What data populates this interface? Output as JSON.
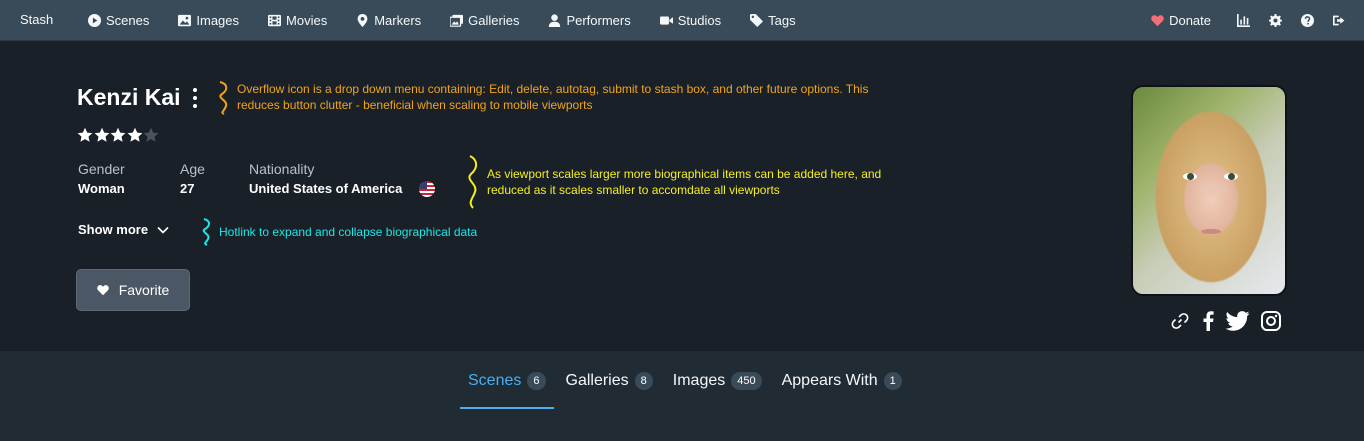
{
  "navbar": {
    "brand": "Stash",
    "items": [
      {
        "label": "Scenes",
        "icon": "play-circle-icon"
      },
      {
        "label": "Images",
        "icon": "image-icon"
      },
      {
        "label": "Movies",
        "icon": "film-icon"
      },
      {
        "label": "Markers",
        "icon": "map-marker-icon"
      },
      {
        "label": "Galleries",
        "icon": "images-icon"
      },
      {
        "label": "Performers",
        "icon": "user-icon"
      },
      {
        "label": "Studios",
        "icon": "video-icon"
      },
      {
        "label": "Tags",
        "icon": "tag-icon"
      }
    ],
    "donate_label": "Donate",
    "right_icons": [
      "chart-icon",
      "gear-icon",
      "help-icon",
      "logout-icon"
    ]
  },
  "performer": {
    "name": "Kenzi Kai",
    "rating": 4,
    "rating_max": 5,
    "bio": [
      {
        "label": "Gender",
        "value": "Woman"
      },
      {
        "label": "Age",
        "value": "27"
      },
      {
        "label": "Nationality",
        "value": "United States of America"
      }
    ],
    "show_more_label": "Show more",
    "favorite_label": "Favorite"
  },
  "annotations": {
    "overflow": "Overflow icon is a drop down menu containing: Edit, delete, autotag, submit to stash box, and other future options. This reduces button clutter - beneficial when scaling to mobile viewports",
    "overflow_line1": "Overflow icon is a drop down menu containing: Edit, delete, autotag, submit to stash box, and other future options. This",
    "overflow_line2": "reduces button clutter - beneficial when scaling to mobile viewports",
    "bio_line1": "As viewport scales larger more biographical items can be added here, and",
    "bio_line2": "reduced as it scales smaller to accomdate all viewports",
    "hotlink": "Hotlink to expand and collapse biographical data"
  },
  "socials": [
    "link-icon",
    "facebook-icon",
    "twitter-icon",
    "instagram-icon"
  ],
  "tabs": [
    {
      "label": "Scenes",
      "count": "6",
      "active": true
    },
    {
      "label": "Galleries",
      "count": "8",
      "active": false
    },
    {
      "label": "Images",
      "count": "450",
      "active": false
    },
    {
      "label": "Appears With",
      "count": "1",
      "active": false
    }
  ],
  "colors": {
    "navbar": "#394b59",
    "accent": "#48aff0",
    "annotation_orange": "#f0a41e",
    "annotation_yellow": "#f5ef1f",
    "annotation_cyan": "#19e8e8",
    "heart": "#f0707a"
  }
}
